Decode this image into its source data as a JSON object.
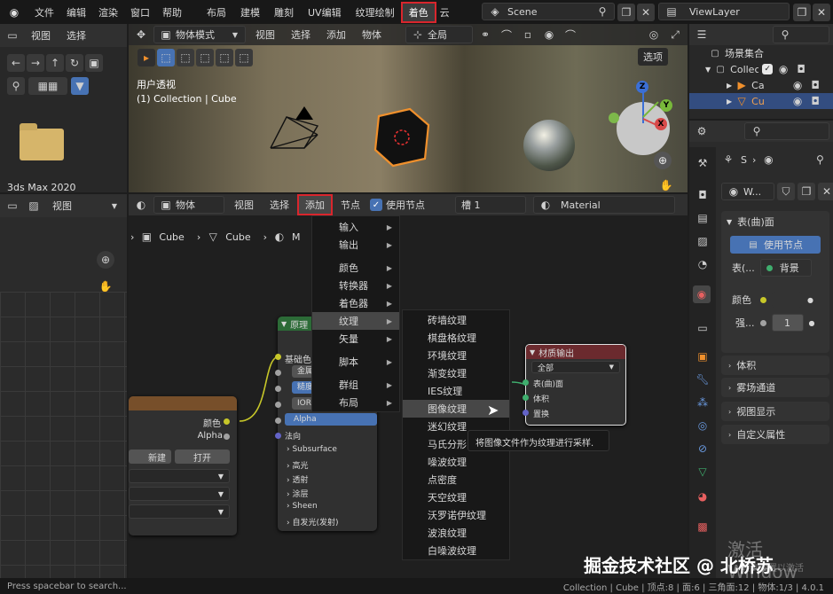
{
  "topbar": {
    "menus": [
      "文件",
      "编辑",
      "渲染",
      "窗口",
      "帮助"
    ],
    "workspaces": [
      "布局",
      "建模",
      "雕刻",
      "UV编辑",
      "纹理绘制",
      "着色",
      "云"
    ],
    "active_workspace": "着色",
    "scene": "Scene",
    "view_layer": "ViewLayer"
  },
  "filebrowser": {
    "header": [
      "视图",
      "选择"
    ],
    "folder_label": "3ds Max 2020"
  },
  "viewport": {
    "mode": "物体模式",
    "menus": [
      "视图",
      "选择",
      "添加",
      "物体"
    ],
    "transform": "全局",
    "options": "选项",
    "overlay_title": "用户透视",
    "overlay_sub": "(1) Collection | Cube",
    "gizmo": {
      "z": "Z",
      "y": "Y",
      "x": "X"
    }
  },
  "image_editor": {
    "view_label": "视图"
  },
  "node_editor": {
    "type": "物体",
    "menus": [
      "视图",
      "选择",
      "添加",
      "节点"
    ],
    "use_nodes": "使用节点",
    "slot": "槽 1",
    "material": "Material",
    "breadcrumb": [
      "Cube",
      "Cube",
      "M"
    ]
  },
  "add_menu": {
    "items": [
      "输入",
      "输出",
      "颜色",
      "转换器",
      "着色器",
      "纹理",
      "矢量",
      "脚本",
      "群组",
      "布局"
    ],
    "arrows": [
      true,
      true,
      true,
      true,
      true,
      true,
      true,
      true,
      true,
      true
    ],
    "active": "纹理"
  },
  "texture_menu": {
    "items": [
      "砖墙纹理",
      "棋盘格纹理",
      "环境纹理",
      "渐变纹理",
      "IES纹理",
      "图像纹理",
      "迷幻纹理",
      "马氏分形",
      "噪波纹理",
      "点密度",
      "天空纹理",
      "沃罗诺伊纹理",
      "波浪纹理",
      "白噪波纹理"
    ],
    "active": "图像纹理",
    "tooltip": "将图像文件作为纹理进行采样."
  },
  "image_node": {
    "out_color": "颜色",
    "out_alpha": "Alpha",
    "new": "新建",
    "open": "打开"
  },
  "bsdf_node": {
    "title": "原理",
    "base_color": "基础色",
    "metallic": "金属",
    "roughness": "糙度",
    "ior": "IOR",
    "alpha": "Alpha",
    "normal": "法向",
    "panels": [
      "Subsurface",
      "高光",
      "透射",
      "涂层",
      "Sheen",
      "自发光(发射)"
    ]
  },
  "output_node": {
    "title": "材质输出",
    "target": "全部",
    "inputs": [
      "表(曲)面",
      "体积",
      "置换"
    ]
  },
  "outliner": {
    "scene_collection": "场景集合",
    "collection": "Collec",
    "items": [
      "Ca",
      "Cu"
    ]
  },
  "properties": {
    "breadcrumb": "S",
    "world": "W...",
    "surface_panel": "表(曲)面",
    "use_nodes": "使用节点",
    "surface_label": "表(...",
    "surface_value": "背景",
    "color_label": "颜色",
    "strength_label": "强...",
    "strength_value": "1",
    "panels": [
      "体积",
      "雾场通道",
      "视图显示",
      "自定义属性"
    ]
  },
  "statusbar": {
    "left": "Press spacebar to search...",
    "right": "Collection | Cube | 顶点:8 | 面:6 | 三角面:12 | 物体:1/3 | 4.0.1"
  },
  "watermark": {
    "activate": "激活 Window",
    "activate_sub": "转到设置以激活",
    "brand": "掘金技术社区 @ 北桥苏"
  },
  "colors": {
    "highlight_red": "#d9262d",
    "accent_blue": "#4772b3",
    "active_orange": "#f0902c",
    "texture_node_header": "#774f2a",
    "shader_node_header": "#2c6b37",
    "output_node_header": "#6b2a2e"
  }
}
